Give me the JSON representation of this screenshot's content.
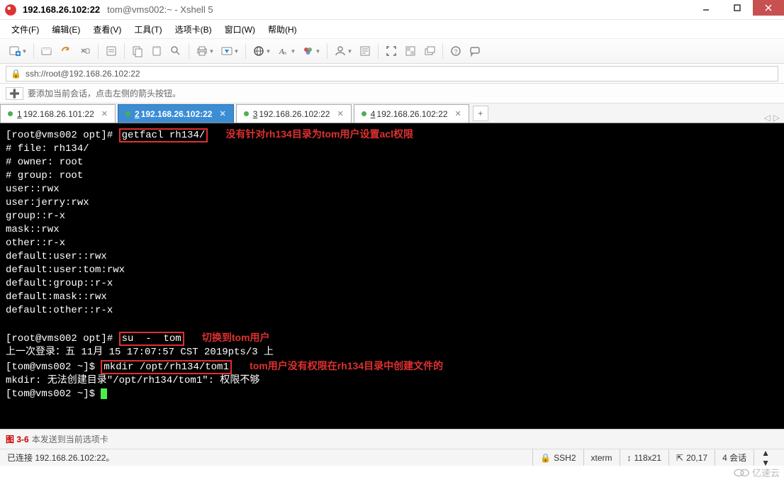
{
  "title": {
    "main": "192.168.26.102:22",
    "sub": "tom@vms002:~ - Xshell 5"
  },
  "menu": {
    "file": "文件(F)",
    "edit": "编辑(E)",
    "view": "查看(V)",
    "tools": "工具(T)",
    "tab": "选项卡(B)",
    "window": "窗口(W)",
    "help": "帮助(H)"
  },
  "address": "ssh://root@192.168.26.102:22",
  "hint": "要添加当前会话，点击左侧的箭头按钮。",
  "tabs": [
    {
      "n": "1",
      "label": "192.168.26.101:22",
      "active": false
    },
    {
      "n": "2",
      "label": "192.168.26.102:22",
      "active": true
    },
    {
      "n": "3",
      "label": "192.168.26.102:22",
      "active": false
    },
    {
      "n": "4",
      "label": "192.168.26.102:22",
      "active": false
    }
  ],
  "term": {
    "prompt1": "[root@vms002 opt]# ",
    "cmd1": "getfacl rh134/",
    "ann1": "没有针对rh134目录为tom用户设置acl权限",
    "l2": "# file: rh134/",
    "l3": "# owner: root",
    "l4": "# group: root",
    "l5": "user::rwx",
    "l6": "user:jerry:rwx",
    "l7": "group::r-x",
    "l8": "mask::rwx",
    "l9": "other::r-x",
    "l10": "default:user::rwx",
    "l11": "default:user:tom:rwx",
    "l12": "default:group::r-x",
    "l13": "default:mask::rwx",
    "l14": "default:other::r-x",
    "blank": " ",
    "prompt2": "[root@vms002 opt]# ",
    "cmd2": "su  -  tom",
    "ann2": "切换到tom用户",
    "l16": "上一次登录：五 11月 15 17:07:57 CST 2019pts/3 上",
    "prompt3": "[tom@vms002 ~]$ ",
    "cmd3": "mkdir /opt/rh134/tom1",
    "ann3": "tom用户没有权限在rh134目录中创建文件的",
    "l18": "mkdir: 无法创建目录\"/opt/rh134/tom1\": 权限不够",
    "prompt4": "[tom@vms002 ~]$ "
  },
  "footer": {
    "fig": "图 3-6",
    "ftext": "本发送到当前选项卡"
  },
  "status": {
    "conn": "已连接 192.168.26.102:22。",
    "proto": "SSH2",
    "term": "xterm",
    "size": "118x21",
    "pos": "20,17",
    "sess": "4 会话"
  },
  "watermark": "亿速云"
}
